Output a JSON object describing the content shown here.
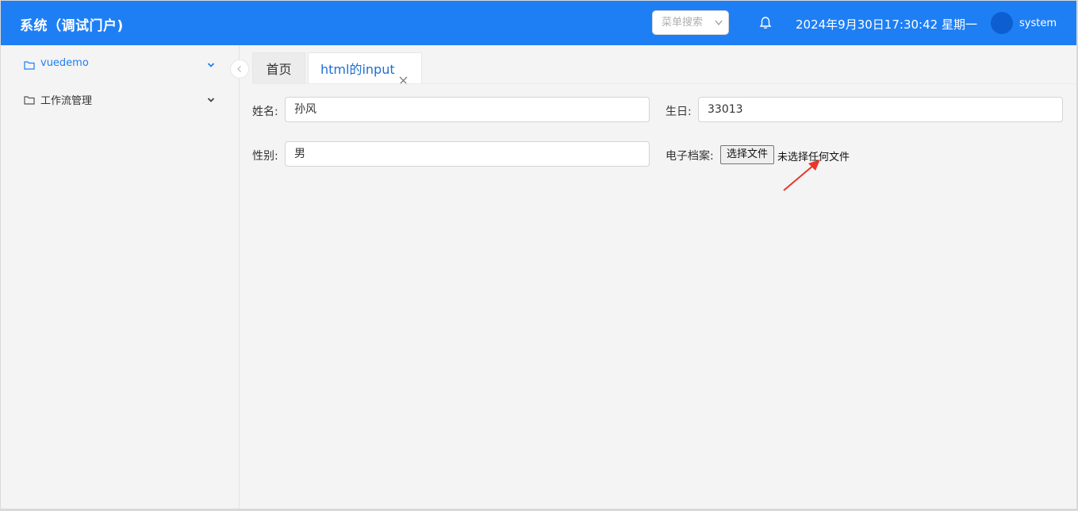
{
  "header": {
    "title": "系统（调试门户)",
    "menu_search_placeholder": "菜单搜索",
    "datetime": "2024年9月30日17:30:42 星期一",
    "username": "system",
    "colors": {
      "bar": "#1e7ff5",
      "avatar": "#0d5fd0"
    },
    "icons": [
      "bell-icon",
      "chevron-down-icon"
    ]
  },
  "sidebar": {
    "items": [
      {
        "label": "vuedemo",
        "active": true,
        "icon": "folder-icon"
      },
      {
        "label": "工作流管理",
        "active": false,
        "icon": "folder-icon"
      }
    ]
  },
  "tabs": {
    "home": "首页",
    "current": "html的input"
  },
  "form": {
    "name_label": "姓名:",
    "name_value": "孙风",
    "birthday_label": "生日:",
    "birthday_value": "33013",
    "gender_label": "性别:",
    "gender_value": "男",
    "file_label": "电子档案:",
    "file_button": "选择文件",
    "file_status": "未选择任何文件"
  }
}
